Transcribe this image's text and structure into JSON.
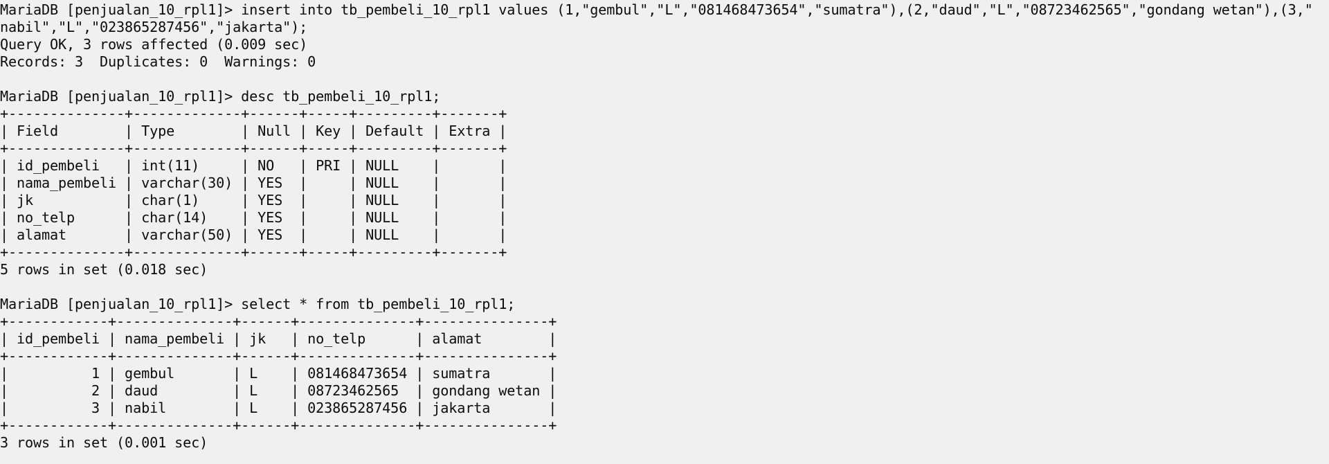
{
  "console": {
    "lines": [
      "MariaDB [penjualan_10_rpl1]> insert into tb_pembeli_10_rpl1 values (1,\"gembul\",\"L\",\"081468473654\",\"sumatra\"),(2,\"daud\",\"L\",\"08723462565\",\"gondang wetan\"),(3,\"",
      "nabil\",\"L\",\"023865287456\",\"jakarta\");",
      "Query OK, 3 rows affected (0.009 sec)",
      "Records: 3  Duplicates: 0  Warnings: 0",
      "",
      "MariaDB [penjualan_10_rpl1]> desc tb_pembeli_10_rpl1;",
      "+--------------+-------------+------+-----+---------+-------+",
      "| Field        | Type        | Null | Key | Default | Extra |",
      "+--------------+-------------+------+-----+---------+-------+",
      "| id_pembeli   | int(11)     | NO   | PRI | NULL    |       |",
      "| nama_pembeli | varchar(30) | YES  |     | NULL    |       |",
      "| jk           | char(1)     | YES  |     | NULL    |       |",
      "| no_telp      | char(14)    | YES  |     | NULL    |       |",
      "| alamat       | varchar(50) | YES  |     | NULL    |       |",
      "+--------------+-------------+------+-----+---------+-------+",
      "5 rows in set (0.018 sec)",
      "",
      "MariaDB [penjualan_10_rpl1]> select * from tb_pembeli_10_rpl1;",
      "+------------+--------------+------+--------------+---------------+",
      "| id_pembeli | nama_pembeli | jk   | no_telp      | alamat        |",
      "+------------+--------------+------+--------------+---------------+",
      "|          1 | gembul       | L    | 081468473654 | sumatra       |",
      "|          2 | daud         | L    | 08723462565  | gondang wetan |",
      "|          3 | nabil        | L    | 023865287456 | jakarta       |",
      "+------------+--------------+------+--------------+---------------+",
      "3 rows in set (0.001 sec)"
    ]
  },
  "colors": {
    "background": "#f0f0f0",
    "text": "#0c0c0c"
  }
}
